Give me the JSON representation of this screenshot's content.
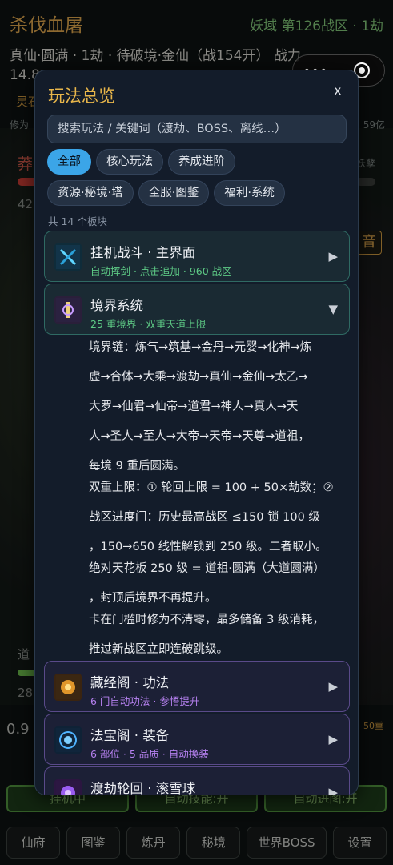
{
  "background": {
    "title": "杀伐血屠",
    "region": "妖域 第126战区 · 1劫",
    "stage_line": "真仙·圆满 · 1劫 · 待破境·金仙（战154开） 战力",
    "stage_number": "14.8",
    "lingqi": "灵石",
    "xiuwei": "修为",
    "right_value": "59亿",
    "enemy_name": "莽",
    "enemy_right": "妖孽",
    "enemy_number": "42",
    "yin_button": "音",
    "dao_label": "道",
    "dao_number": "28.",
    "left_number": "0.9",
    "right_badge": "50重",
    "toggle_buttons": [
      "挂机中",
      "自动技能:开",
      "自动进图:开"
    ],
    "bottom_nav": [
      "仙府",
      "图鉴",
      "炼丹",
      "秘境",
      "世界BOSS",
      "设置"
    ]
  },
  "capsule": {
    "more": "•••"
  },
  "modal": {
    "title": "玩法总览",
    "close": "x",
    "search_placeholder": "搜索玩法 / 关键词（渡劫、BOSS、离线…）",
    "filters_row1": [
      "全部",
      "核心玩法",
      "养成进阶"
    ],
    "filters_row2": [
      "资源·秘境·塔",
      "全服·图鉴",
      "福利·系统"
    ],
    "count": "共 14 个板块",
    "cards": [
      {
        "title": "挂机战斗 · 主界面",
        "subtitle": "自动挥剑 · 点击追加 · 960 战区",
        "arrow": "▶",
        "icon": "sword-icon"
      },
      {
        "title": "境界系统",
        "subtitle": "25 重境界 · 双重天道上限",
        "arrow": "▼",
        "icon": "realm-icon"
      },
      {
        "title": "藏经阁 · 功法",
        "subtitle": "6 门自动功法 · 参悟提升",
        "arrow": "▶",
        "icon": "scripture-icon"
      },
      {
        "title": "法宝阁 · 装备",
        "subtitle": "6 部位 · 5 品质 · 自动换装",
        "arrow": "▶",
        "icon": "treasure-icon"
      },
      {
        "title": "渡劫轮回 · 滚雪球",
        "subtitle": "",
        "arrow": "▶",
        "icon": "tribulation-icon"
      }
    ],
    "detail_lines": [
      "境界链：炼气→筑基→金丹→元婴→化神→炼",
      "虚→合体→大乘→渡劫→真仙→金仙→太乙→",
      "大罗→仙君→仙帝→道君→神人→真人→天",
      "人→圣人→至人→大帝→天帝→天尊→道祖，",
      "每境 9 重后圆满。",
      "双重上限：① 轮回上限 = 100 + 50×劫数；②",
      "战区进度门：历史最高战区 ≤150 锁 100 级",
      "，150→650 线性解锁到 250 级。二者取小。",
      "绝对天花板 250 级 = 道祖·圆满（大道圆满）",
      "，封顶后境界不再提升。",
      "卡在门槛时修为不清零，最多储备 3 级消耗，",
      "推过新战区立即连破跳级。"
    ]
  },
  "colors": {
    "modal_bg": "#131c2a",
    "accent_gold": "#e8b64a",
    "chip_active": "#3ba5e8",
    "green_sub": "#5ecb86",
    "purple_sub": "#b681f0"
  }
}
